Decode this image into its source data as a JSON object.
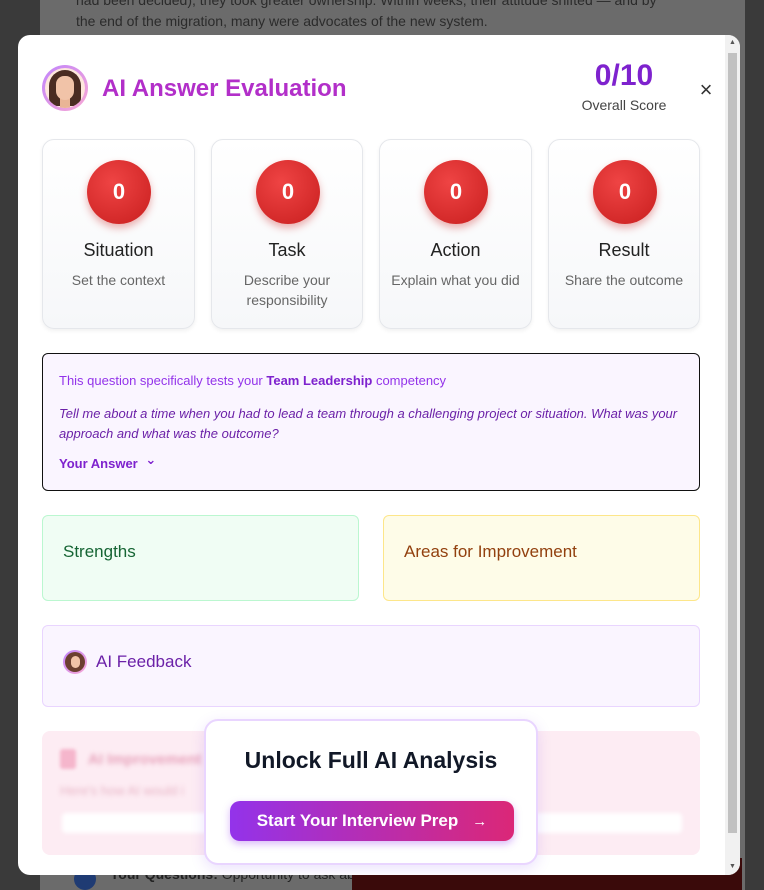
{
  "background": {
    "line1": "had been decided), they took greater ownership. Within weeks, their attitude shifted — and by",
    "line2": "the end of the migration, many were advocates of the new system.",
    "bottom_bold": "Your Questions:",
    "bottom_text": " Opportunity to ask ab"
  },
  "header": {
    "title": "AI Answer Evaluation",
    "score": "0/10",
    "score_label": "Overall Score",
    "close_label": "×"
  },
  "star_cards": [
    {
      "score": "0",
      "name": "Situation",
      "desc": "Set the context"
    },
    {
      "score": "0",
      "name": "Task",
      "desc": "Describe your responsibility"
    },
    {
      "score": "0",
      "name": "Action",
      "desc": "Explain what you did"
    },
    {
      "score": "0",
      "name": "Result",
      "desc": "Share the outcome"
    }
  ],
  "question": {
    "prefix": "This question specifically tests your ",
    "competency": "Team Leadership",
    "suffix": " competency",
    "text": "Tell me about a time when you had to lead a team through a challenging project or situation. What was your approach and what was the outcome?",
    "answer_toggle": "Your Answer",
    "answer_chevron": "⌄"
  },
  "strengths": {
    "title": "Strengths"
  },
  "improvement": {
    "title": "Areas for Improvement"
  },
  "feedback": {
    "title": "AI Feedback"
  },
  "locked": {
    "title": "AI Improvement",
    "subtitle": "Here's how AI would i"
  },
  "unlock": {
    "title": "Unlock Full AI Analysis",
    "button": "Start Your Interview Prep",
    "arrow": "→"
  },
  "scrollbar": {
    "up": "▲",
    "down": "▼"
  }
}
